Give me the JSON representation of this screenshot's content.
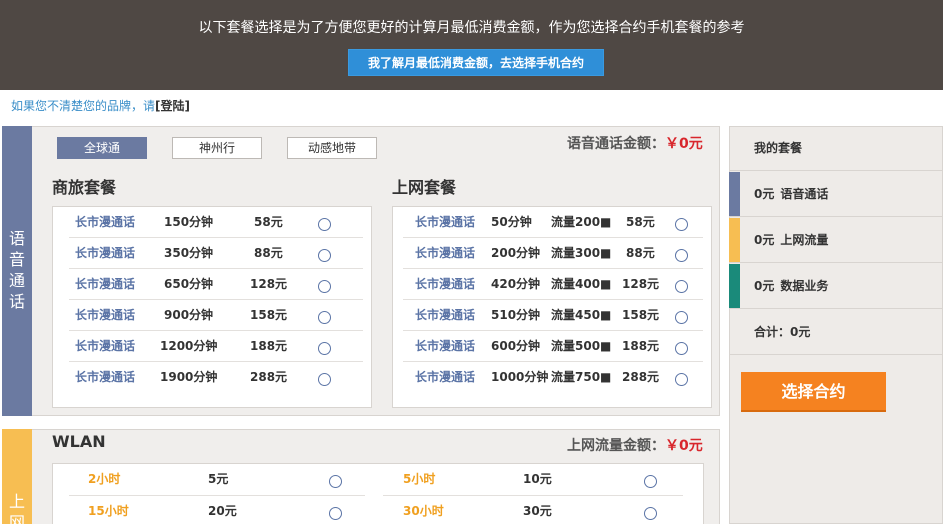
{
  "banner": {
    "text": "以下套餐选择是为了方便您更好的计算月最低消费金额，作为您选择合约手机套餐的参考",
    "button": "我了解月最低消费金额，去选择手机合约"
  },
  "login": {
    "prefix": "如果您不清楚您的品牌，请",
    "link": "[登陆]"
  },
  "voice": {
    "side_label": [
      "语",
      "音",
      "通",
      "话"
    ],
    "tabs": [
      "全球通",
      "神州行",
      "动感地带"
    ],
    "amount_label": "语音通话金额：",
    "amount_value": "￥0元",
    "business": {
      "title": "商旅套餐",
      "rows": [
        {
          "name": "长市漫通话",
          "minutes": "150分钟",
          "price": "58元"
        },
        {
          "name": "长市漫通话",
          "minutes": "350分钟",
          "price": "88元"
        },
        {
          "name": "长市漫通话",
          "minutes": "650分钟",
          "price": "128元"
        },
        {
          "name": "长市漫通话",
          "minutes": "900分钟",
          "price": "158元"
        },
        {
          "name": "长市漫通话",
          "minutes": "1200分钟",
          "price": "188元"
        },
        {
          "name": "长市漫通话",
          "minutes": "1900分钟",
          "price": "288元"
        }
      ]
    },
    "internet": {
      "title": "上网套餐",
      "rows": [
        {
          "name": "长市漫通话",
          "minutes": "50分钟",
          "data": "流量200■",
          "price": "58元"
        },
        {
          "name": "长市漫通话",
          "minutes": "200分钟",
          "data": "流量300■",
          "price": "88元"
        },
        {
          "name": "长市漫通话",
          "minutes": "420分钟",
          "data": "流量400■",
          "price": "128元"
        },
        {
          "name": "长市漫通话",
          "minutes": "510分钟",
          "data": "流量450■",
          "price": "158元"
        },
        {
          "name": "长市漫通话",
          "minutes": "600分钟",
          "data": "流量500■",
          "price": "188元"
        },
        {
          "name": "长市漫通话",
          "minutes": "1000分钟",
          "data": "流量750■",
          "price": "288元"
        }
      ]
    }
  },
  "sidebar": {
    "title": "我的套餐",
    "items": [
      {
        "amount": "0元",
        "label": "语音通话",
        "color": "#6b7aa1"
      },
      {
        "amount": "0元",
        "label": "上网流量",
        "color": "#f7be52"
      },
      {
        "amount": "0元",
        "label": "数据业务",
        "color": "#1a8a7a"
      }
    ],
    "total": "合计：0元",
    "button": "选择合约"
  },
  "wlan": {
    "title": "WLAN",
    "side_label": [
      "上",
      "网"
    ],
    "amount_label": "上网流量金额：",
    "amount_value": "￥0元",
    "left_rows": [
      {
        "hours": "2小时",
        "price": "5元"
      },
      {
        "hours": "15小时",
        "price": "20元"
      }
    ],
    "right_rows": [
      {
        "hours": "5小时",
        "price": "10元"
      },
      {
        "hours": "30小时",
        "price": "30元"
      }
    ]
  }
}
